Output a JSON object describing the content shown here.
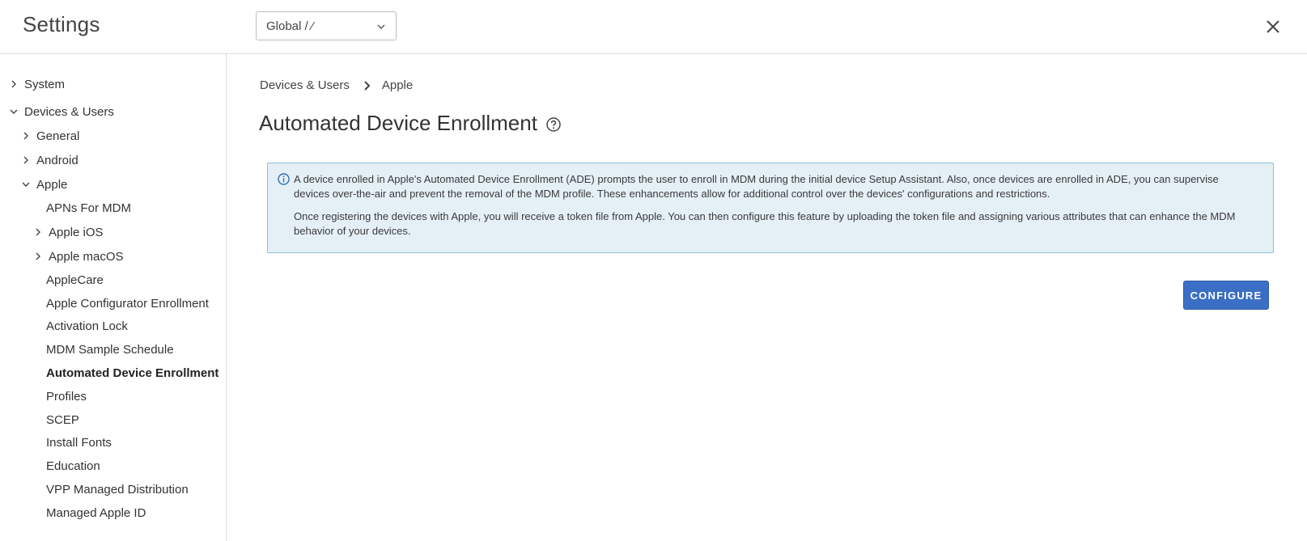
{
  "header": {
    "title": "Settings",
    "scope_select": {
      "value": "Global / ⁄"
    }
  },
  "sidebar": {
    "items": [
      {
        "label": "System",
        "caret": "right"
      },
      {
        "label": "Devices & Users",
        "caret": "down"
      },
      {
        "label": "General",
        "caret": "right"
      },
      {
        "label": "Android",
        "caret": "right"
      },
      {
        "label": "Apple",
        "caret": "down"
      },
      {
        "label": "APNs For MDM",
        "caret": "none"
      },
      {
        "label": "Apple iOS",
        "caret": "right"
      },
      {
        "label": "Apple macOS",
        "caret": "right"
      },
      {
        "label": "AppleCare",
        "caret": "none"
      },
      {
        "label": "Apple Configurator Enrollment",
        "caret": "none"
      },
      {
        "label": "Activation Lock",
        "caret": "none"
      },
      {
        "label": "MDM Sample Schedule",
        "caret": "none"
      },
      {
        "label": "Automated Device Enrollment",
        "caret": "none",
        "active": true
      },
      {
        "label": "Profiles",
        "caret": "none"
      },
      {
        "label": "SCEP",
        "caret": "none"
      },
      {
        "label": "Install Fonts",
        "caret": "none"
      },
      {
        "label": "Education",
        "caret": "none"
      },
      {
        "label": "VPP Managed Distribution",
        "caret": "none"
      },
      {
        "label": "Managed Apple ID",
        "caret": "none"
      }
    ]
  },
  "main": {
    "breadcrumb": [
      "Devices & Users",
      "Apple"
    ],
    "title": "Automated Device Enrollment",
    "info": {
      "para1": "A device enrolled in Apple's Automated Device Enrollment (ADE) prompts the user to enroll in MDM during the initial device Setup Assistant. Also, once devices are enrolled in ADE, you can supervise devices over-the-air and prevent the removal of the MDM profile. These enhancements allow for additional control over the devices' configurations and restrictions.",
      "para2": "Once registering the devices with Apple, you will receive a token file from Apple. You can then configure this feature by uploading the token file and assigning various attributes that can enhance the MDM behavior of your devices."
    },
    "configure_label": "CONFIGURE"
  },
  "colors": {
    "accent": "#3b6fc6",
    "info_bg": "#e5f0f6",
    "info_border": "#8cc0dc",
    "info_icon": "#2f6fb8"
  },
  "icons": {
    "scope_select": "chevron-down-icon",
    "close": "close-icon",
    "breadcrumb_sep": "chevron-right-icon",
    "help": "help-circle-icon",
    "info": "info-icon"
  }
}
